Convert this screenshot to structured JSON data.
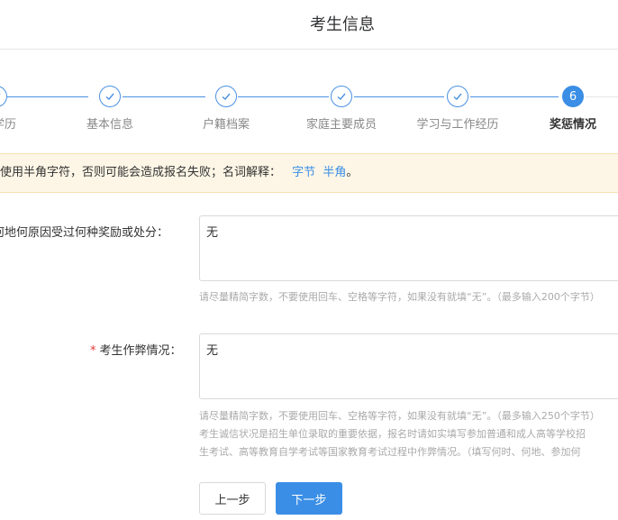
{
  "header": {
    "title": "考生信息"
  },
  "steps": [
    {
      "label": "学历",
      "state": "done"
    },
    {
      "label": "基本信息",
      "state": "done"
    },
    {
      "label": "户籍档案",
      "state": "done"
    },
    {
      "label": "家庭主要成员",
      "state": "done"
    },
    {
      "label": "学习与工作经历",
      "state": "done"
    },
    {
      "label": "奖惩情况",
      "state": "active",
      "number": "6"
    }
  ],
  "notice": {
    "text": "使用半角字符，否则可能会造成报名失败；名词解释：",
    "link1": "字节",
    "link2": "半角",
    "end": "。"
  },
  "fields": {
    "reward": {
      "label": "何地何原因受过何种奖励或处分：",
      "value": "无",
      "hint": "请尽量精简字数，不要使用回车、空格等字符，如果没有就填“无”。（最多输入200个字节）"
    },
    "cheating": {
      "label": "考生作弊情况：",
      "required_mark": "*",
      "value": "无",
      "hint1": "请尽量精简字数，不要使用回车、空格等字符，如果没有就填“无”。（最多输入250个字节）",
      "hint2": "考生诚信状况是招生单位录取的重要依据，报名时请如实填写参加普通和成人高等学校招",
      "hint3": "生考试、高等教育自学考试等国家教育考试过程中作弊情况。（填写何时、何地、参加何"
    }
  },
  "buttons": {
    "prev": "上一步",
    "next": "下一步"
  },
  "colors": {
    "primary": "#3a8ee6",
    "notice_bg": "#fdf6e6",
    "required": "#e53935"
  }
}
